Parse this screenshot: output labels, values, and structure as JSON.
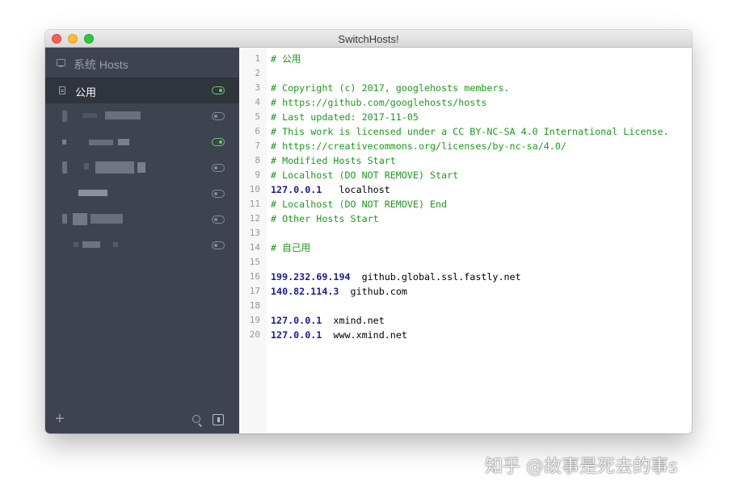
{
  "window": {
    "title": "SwitchHosts!"
  },
  "sidebar": {
    "title": "系统 Hosts",
    "items": [
      {
        "label": "公用",
        "enabled": true,
        "active": true
      },
      {
        "label": "",
        "enabled": false,
        "active": false
      },
      {
        "label": "",
        "enabled": true,
        "active": false
      },
      {
        "label": "",
        "enabled": false,
        "active": false
      },
      {
        "label": "",
        "enabled": false,
        "active": false
      },
      {
        "label": "",
        "enabled": false,
        "active": false
      },
      {
        "label": "",
        "enabled": false,
        "active": false
      }
    ],
    "add_label": "+"
  },
  "editor": {
    "lines": [
      {
        "n": "1",
        "c": "# 公用"
      },
      {
        "n": "2",
        "c": ""
      },
      {
        "n": "3",
        "c": "# Copyright (c) 2017, googlehosts members."
      },
      {
        "n": "4",
        "c": "# https://github.com/googlehosts/hosts"
      },
      {
        "n": "5",
        "c": "# Last updated: 2017-11-05"
      },
      {
        "n": "6",
        "c": "# This work is licensed under a CC BY-NC-SA 4.0 International License."
      },
      {
        "n": "7",
        "c": "# https://creativecommons.org/licenses/by-nc-sa/4.0/"
      },
      {
        "n": "8",
        "c": "# Modified Hosts Start"
      },
      {
        "n": "9",
        "c": "# Localhost (DO NOT REMOVE) Start"
      },
      {
        "n": "10",
        "ip": "127.0.0.1",
        "host": "   localhost"
      },
      {
        "n": "11",
        "c": "# Localhost (DO NOT REMOVE) End"
      },
      {
        "n": "12",
        "c": "# Other Hosts Start"
      },
      {
        "n": "13",
        "c": ""
      },
      {
        "n": "14",
        "c": "# 自己用"
      },
      {
        "n": "15",
        "c": ""
      },
      {
        "n": "16",
        "ip": "199.232.69.194",
        "host": "  github.global.ssl.fastly.net"
      },
      {
        "n": "17",
        "ip": "140.82.114.3",
        "host": "  github.com"
      },
      {
        "n": "18",
        "c": ""
      },
      {
        "n": "19",
        "ip": "127.0.0.1",
        "host": "  xmind.net"
      },
      {
        "n": "20",
        "ip": "127.0.0.1",
        "host": "  www.xmind.net"
      }
    ]
  },
  "watermark": "知乎 @故事是死去的事s",
  "colors": {
    "sidebar_bg": "#3d434f",
    "sidebar_active_bg": "#2f343d",
    "toggle_on": "#5fd05d",
    "comment": "#1a9c1a",
    "ip": "#1a1aa6"
  }
}
